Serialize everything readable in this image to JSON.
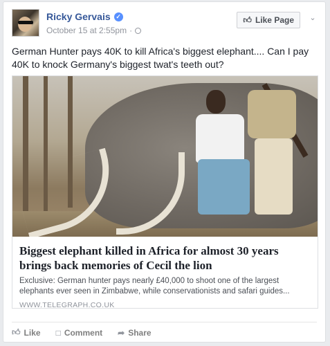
{
  "post": {
    "author": "Ricky Gervais",
    "timestamp": "October 15 at 2:55pm",
    "separator": "·",
    "like_page_label": "Like Page",
    "text": "German Hunter pays 40K to kill Africa's biggest elephant.... Can I pay 40K to knock Germany's biggest twat's teeth out?"
  },
  "link_preview": {
    "title": "Biggest elephant killed in Africa for almost 30 years brings back memories of Cecil the lion",
    "description": "Exclusive: German hunter pays nearly £40,000 to shoot one of the largest elephants ever seen in Zimbabwe, while conservationists and safari guides...",
    "domain": "WWW.TELEGRAPH.CO.UK"
  },
  "actions": {
    "like": "Like",
    "comment": "Comment",
    "share": "Share"
  },
  "icons": {
    "verified": "verified-badge-icon",
    "like_page": "thumbs-up-icon",
    "chevron": "chevron-down-icon",
    "privacy": "globe-icon",
    "like": "thumbs-up-icon",
    "comment": "speech-bubble-icon",
    "share": "share-arrow-icon"
  },
  "colors": {
    "author_link": "#365899",
    "verified_badge": "#5890ff",
    "meta_text": "#90949c"
  }
}
